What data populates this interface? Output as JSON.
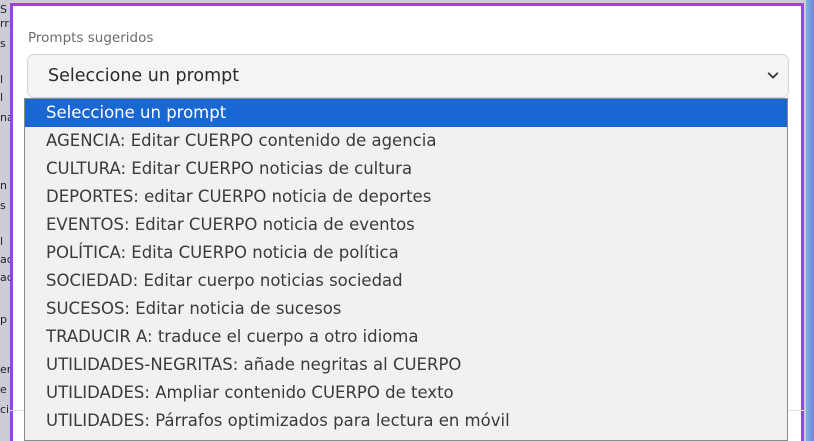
{
  "background_fragments": [
    "S",
    "rri",
    "s",
    "l",
    "l",
    "na",
    "n",
    "s",
    "l",
    "ac",
    "ac",
    "p",
    "er",
    "e",
    "ci"
  ],
  "field": {
    "label": "Prompts sugeridos",
    "selected_value": "Seleccione un prompt"
  },
  "dropdown": {
    "options": [
      "Seleccione un prompt",
      "AGENCIA: Editar CUERPO contenido de agencia",
      "CULTURA: Editar CUERPO noticias de cultura",
      "DEPORTES: editar CUERPO noticia de deportes",
      "EVENTOS: Editar CUERPO noticia de eventos",
      "POLÍTICA: Edita CUERPO noticia de política",
      "SOCIEDAD: Editar cuerpo noticias sociedad",
      "SUCESOS: Editar noticia de sucesos",
      "TRADUCIR A: traduce el cuerpo a otro idioma",
      "UTILIDADES-NEGRITAS: añade negritas al CUERPO",
      "UTILIDADES: Ampliar contenido CUERPO de texto",
      "UTILIDADES: Párrafos optimizados para lectura en móvil"
    ],
    "highlighted_index": 0
  },
  "icons": {
    "select_chevron": "chevron-down-icon"
  },
  "colors": {
    "modal_border": "#a83ce0",
    "highlight": "#1967d2"
  }
}
